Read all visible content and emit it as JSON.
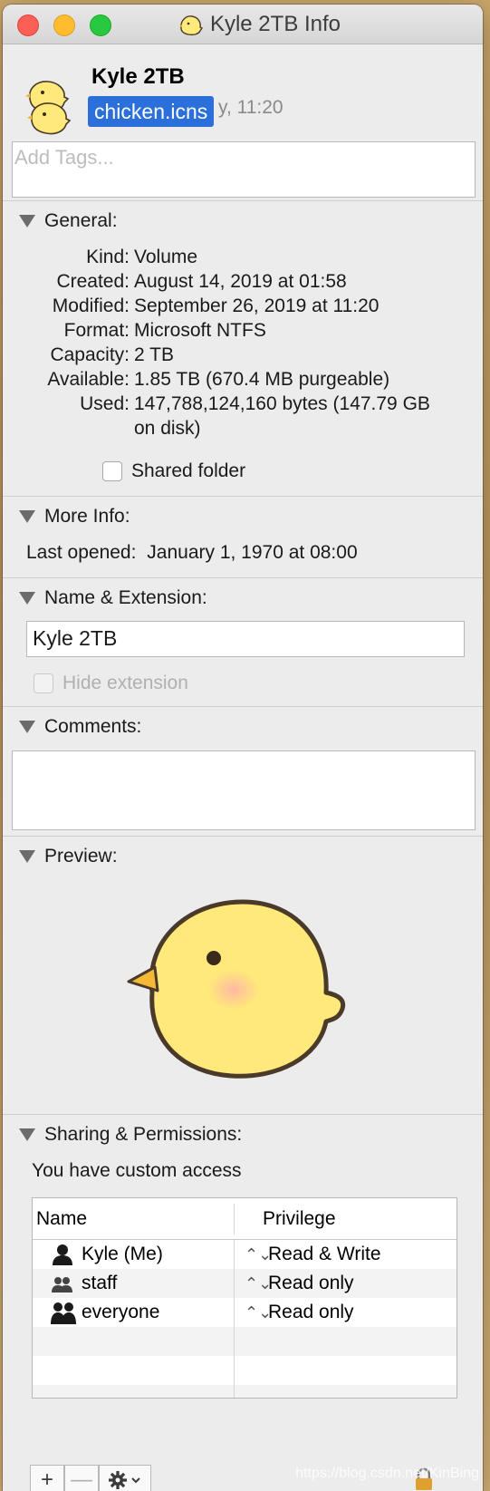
{
  "window": {
    "title": "Kyle 2TB Info"
  },
  "header": {
    "volume_name": "Kyle 2TB",
    "subtitle_partial": "y, 11:20",
    "selected_file_label": "chicken.icns",
    "tags_placeholder": "Add Tags..."
  },
  "general": {
    "heading": "General:",
    "rows": [
      {
        "label": "Kind:",
        "value": "Volume"
      },
      {
        "label": "Created:",
        "value": "August 14, 2019 at 01:58"
      },
      {
        "label": "Modified:",
        "value": "September 26, 2019 at 11:20"
      },
      {
        "label": "Format:",
        "value": "Microsoft NTFS"
      },
      {
        "label": "Capacity:",
        "value": "2 TB"
      },
      {
        "label": "Available:",
        "value": "1.85 TB (670.4 MB purgeable)"
      },
      {
        "label": "Used:",
        "value": "147,788,124,160 bytes (147.79 GB",
        "value_line2": "on disk)"
      }
    ],
    "shared_folder_label": "Shared folder"
  },
  "more_info": {
    "heading": "More Info:",
    "last_opened_label": "Last opened:",
    "last_opened_value": "January 1, 1970 at 08:00"
  },
  "name_extension": {
    "heading": "Name & Extension:",
    "name_value": "Kyle 2TB",
    "hide_extension_label": "Hide extension"
  },
  "comments": {
    "heading": "Comments:"
  },
  "preview": {
    "heading": "Preview:"
  },
  "sharing": {
    "heading": "Sharing & Permissions:",
    "access_text": "You have custom access",
    "col_name": "Name",
    "col_privilege": "Privilege",
    "rows": [
      {
        "name": "Kyle (Me)",
        "privilege": "Read & Write",
        "icon": "single-user-icon"
      },
      {
        "name": "staff",
        "privilege": "Read only",
        "icon": "group-icon"
      },
      {
        "name": "everyone",
        "privilege": "Read only",
        "icon": "everyone-icon"
      }
    ]
  },
  "footer": {
    "add_label": "+",
    "remove_label": "—",
    "watermark": "https://blog.csdn.net/KinBing"
  },
  "colors": {
    "selection": "#2b6fdb",
    "close": "#fd5f57",
    "minimize": "#febc2e",
    "maximize": "#28c840",
    "chick_body": "#ffe97a"
  }
}
